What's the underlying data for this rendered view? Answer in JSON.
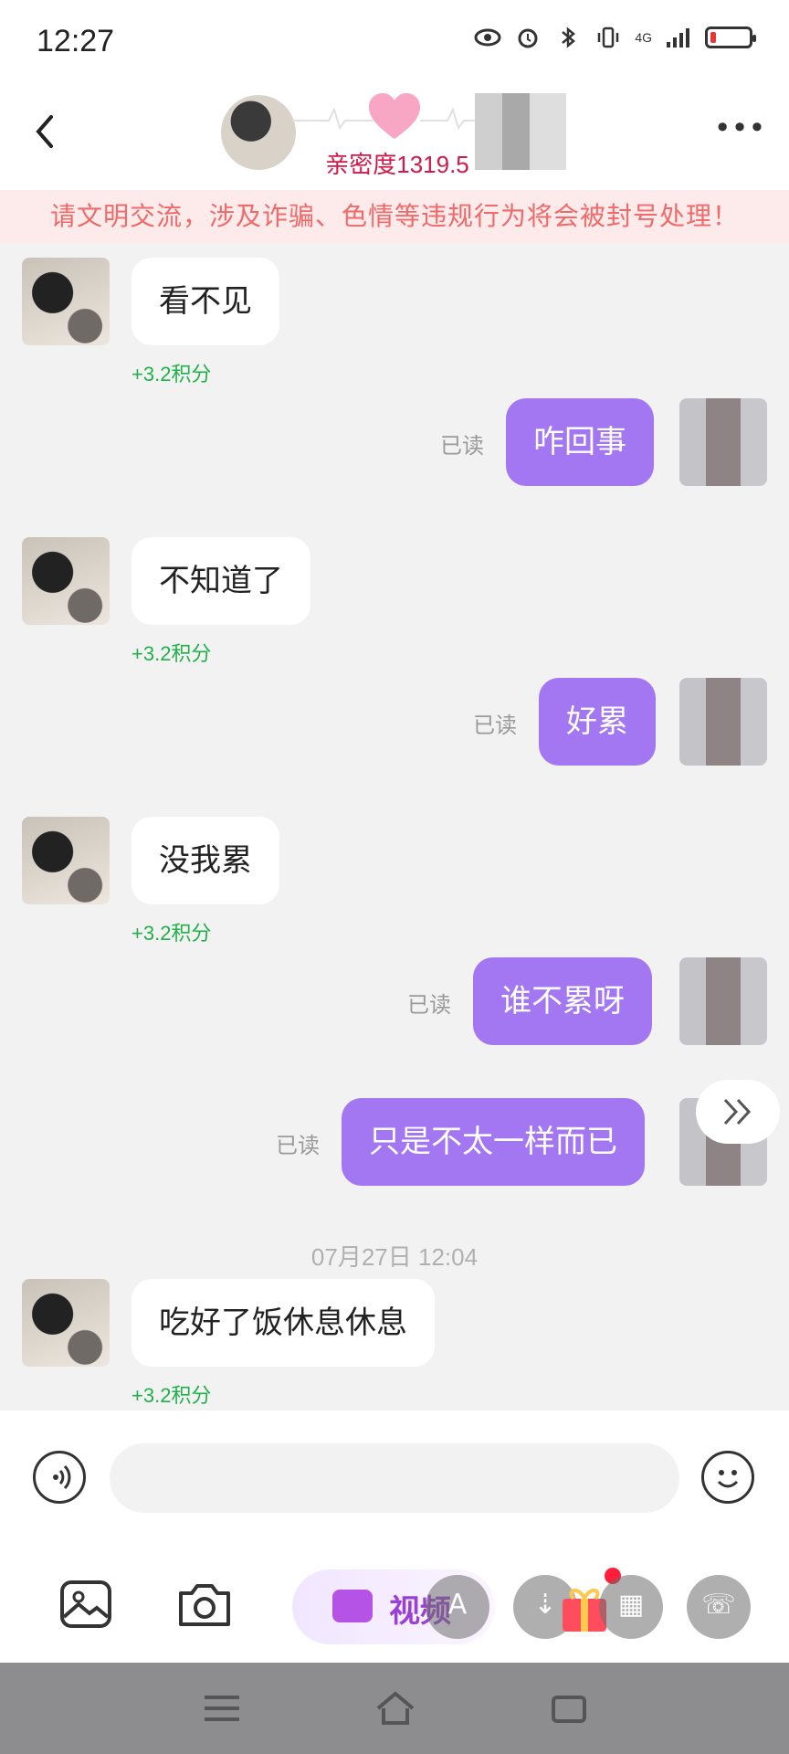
{
  "status_bar": {
    "time": "12:27",
    "network": "4G",
    "icons": [
      "eye-icon",
      "alarm-icon",
      "bluetooth-icon",
      "vibrate-icon",
      "signal-icon",
      "battery-icon"
    ],
    "battery_color": "#e53935"
  },
  "header": {
    "intimacy_label": "亲密度1319.5",
    "back_icon": "chevron-left-icon",
    "more_icon": "more-dots-icon",
    "heart_color": "#f48fb1"
  },
  "warning": "请文明交流，涉及诈骗、色情等违规行为将会被封号处理！",
  "messages": [
    {
      "side": "left",
      "text": "看不见",
      "points": "+3.2积分"
    },
    {
      "side": "right",
      "text": "咋回事",
      "status": "已读"
    },
    {
      "side": "left",
      "text": "不知道了",
      "points": "+3.2积分"
    },
    {
      "side": "right",
      "text": "好累",
      "status": "已读"
    },
    {
      "side": "left",
      "text": "没我累",
      "points": "+3.2积分"
    },
    {
      "side": "right",
      "text": "谁不累呀",
      "status": "已读"
    },
    {
      "side": "right",
      "text": "只是不太一样而已",
      "status": "已读"
    },
    {
      "timestamp": "07月27日 12:04"
    },
    {
      "side": "left",
      "text": "吃好了饭休息休息",
      "points": "+3.2积分"
    }
  ],
  "input": {
    "placeholder": "",
    "value": ""
  },
  "toolbar": {
    "video_label": "视频",
    "fab_a": "A",
    "fab_b": "⇣"
  },
  "colors": {
    "bubble_sent": "#a377f2",
    "points": "#21b04b",
    "warning_text": "#f06a6a"
  }
}
